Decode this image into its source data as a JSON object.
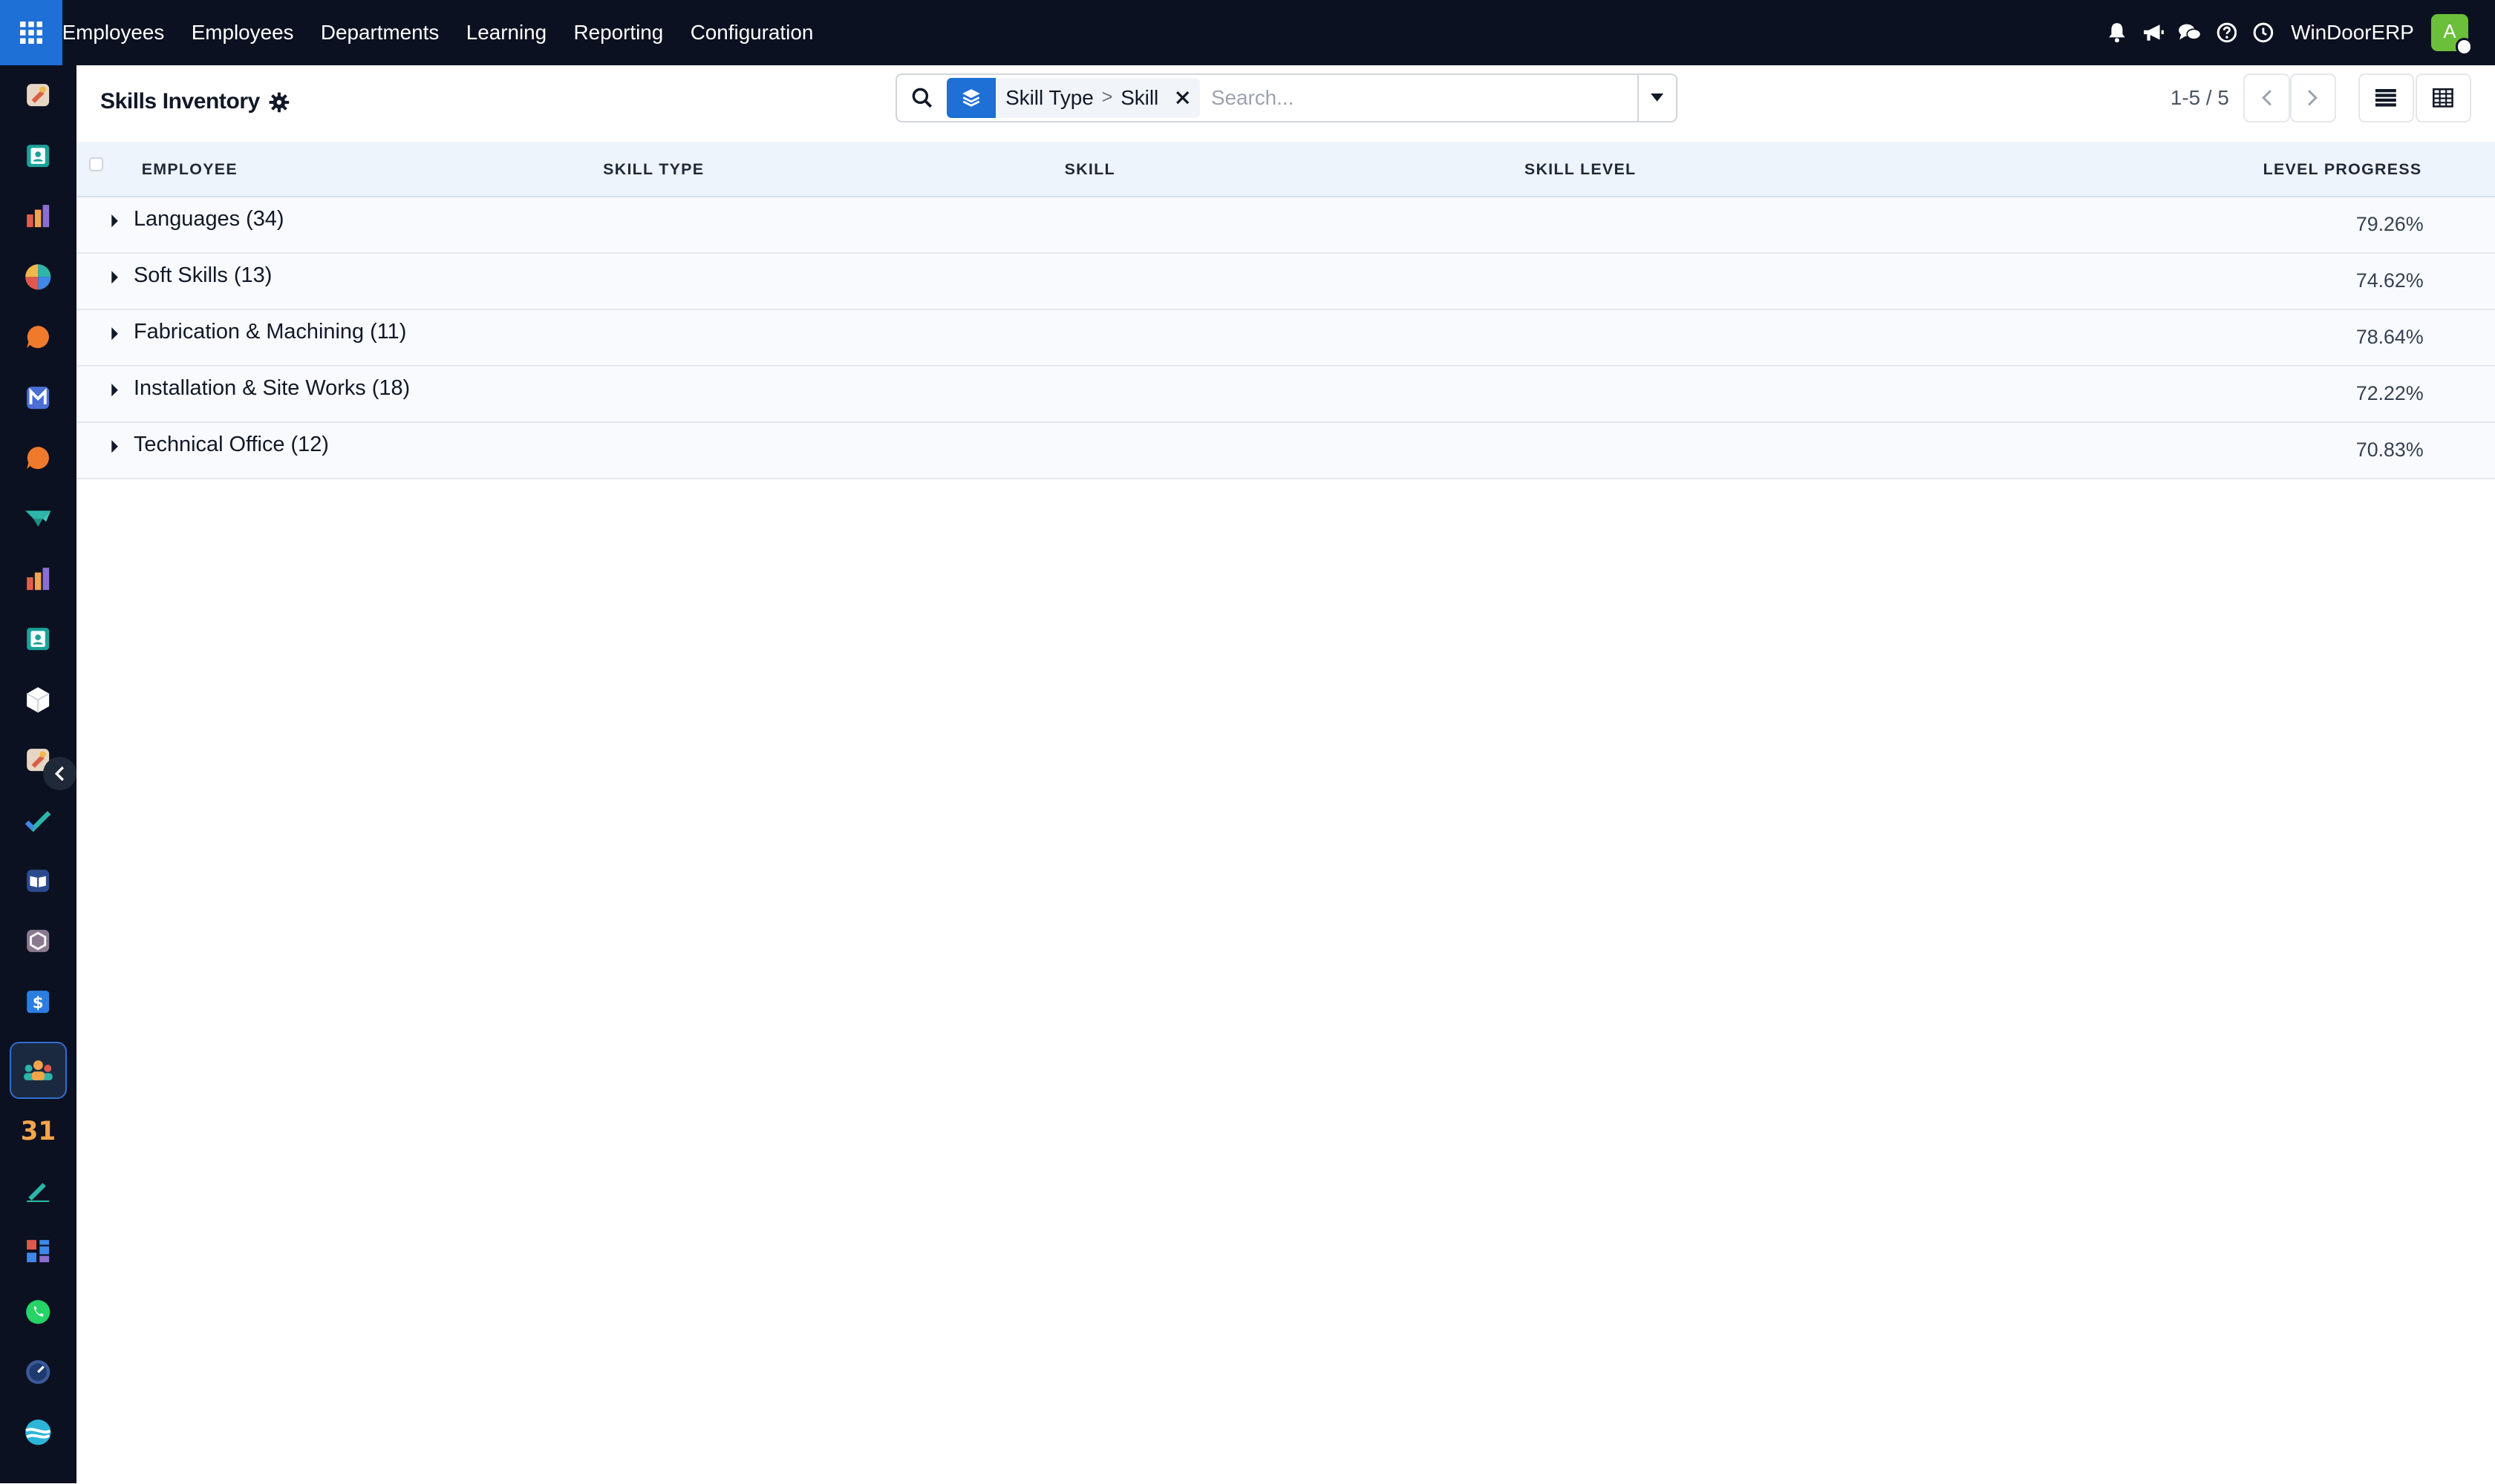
{
  "topbar": {
    "nav": [
      "Employees",
      "Employees",
      "Departments",
      "Learning",
      "Reporting",
      "Configuration"
    ],
    "company": "WinDoorERP",
    "avatar_letter": "A",
    "icons": [
      "bell-icon",
      "megaphone-icon",
      "chat-icon",
      "help-icon",
      "clock-icon"
    ]
  },
  "sidebar": {
    "apps": [
      "discuss-app",
      "contacts-app",
      "reporting-app",
      "crm-app",
      "livechat-app",
      "email-marketing-app",
      "chat-app",
      "project-app",
      "dashboards-app",
      "employees-directory-app",
      "inventory-app",
      "sales-app",
      "todo-app",
      "knowledge-app",
      "products-app",
      "accounting-app",
      "employees-app",
      "calendar-app",
      "sign-app",
      "spreadsheet-app",
      "whatsapp-app",
      "timesheets-app",
      "website-app"
    ],
    "active": "employees-app"
  },
  "control": {
    "title": "Skills Inventory",
    "facet": {
      "parts": [
        "Skill Type",
        "Skill"
      ],
      "separator": ">"
    },
    "search_placeholder": "Search...",
    "pager": "1-5 / 5"
  },
  "table": {
    "columns": [
      "EMPLOYEE",
      "SKILL TYPE",
      "SKILL",
      "SKILL LEVEL",
      "LEVEL PROGRESS"
    ],
    "groups": [
      {
        "label": "Languages (34)",
        "value": "79.26%"
      },
      {
        "label": "Soft Skills (13)",
        "value": "74.62%"
      },
      {
        "label": "Fabrication & Machining (11)",
        "value": "78.64%"
      },
      {
        "label": "Installation & Site Works (18)",
        "value": "72.22%"
      },
      {
        "label": "Technical Office (12)",
        "value": "70.83%"
      }
    ]
  },
  "colors": {
    "navbar": "#0b1120",
    "accent": "#1e6fd6",
    "header_bg": "#eef4fb",
    "avatar": "#6bbf3a"
  }
}
